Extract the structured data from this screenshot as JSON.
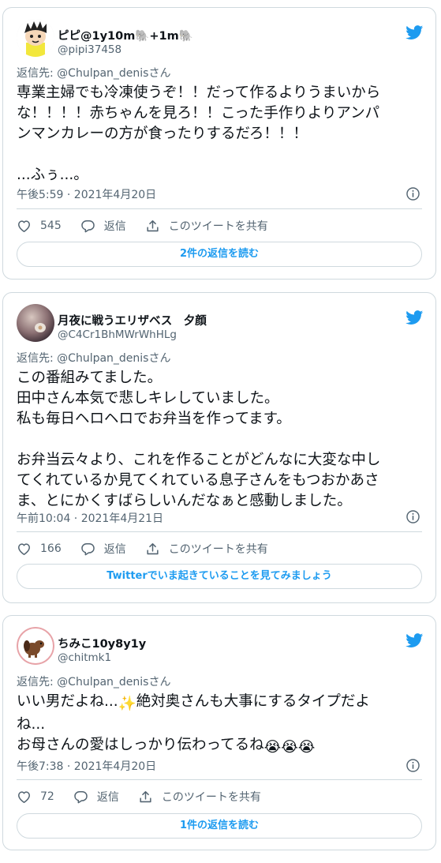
{
  "colors": {
    "accent": "#1d9bf0",
    "secondary_text": "#536471",
    "border": "#cfd9de",
    "text": "#0f1419"
  },
  "tweets": [
    {
      "author": {
        "name": "ピピ@1y10m🐘+1m🐘",
        "handle": "@pipi37458"
      },
      "reply_to": {
        "prefix": "返信先: ",
        "mention": "@Chulpan_denisさん"
      },
      "lines": [
        "専業主婦でも冷凍使うぞ！！だって作るよりうまいから",
        "な！！！！赤ちゃんを見ろ！！こった手作りよりアンパ",
        "ンマンカレーの方が食ったりするだろ！！！",
        "",
        "...ふぅ...。"
      ],
      "timestamp": "午後5:59 · 2021年4月20日",
      "like_count": "545",
      "reply_label": "返信",
      "share_label": "このツイートを共有",
      "button_label": "2件の返信を読む"
    },
    {
      "author": {
        "name": "月夜に戦うエリザベス　夕顔",
        "handle": "@C4Cr1BhMWrWhHLg"
      },
      "reply_to": {
        "prefix": "返信先: ",
        "mention": "@Chulpan_denisさん"
      },
      "lines": [
        "この番組みてました。",
        "田中さん本気で悲しキレしていました。",
        "私も毎日ヘロヘロでお弁当を作ってます。",
        "",
        "お弁当云々より、これを作ることがどんなに大変な中し",
        "てくれているか見てくれている息子さんをもつおかあさ",
        "ま、とにかくすばらしいんだなぁと感動しました。"
      ],
      "timestamp": "午前10:04 · 2021年4月21日",
      "like_count": "166",
      "reply_label": "返信",
      "share_label": "このツイートを共有",
      "button_label": "Twitterでいま起きていることを見てみましょう"
    },
    {
      "author": {
        "name": "ちみこ10y8y1y",
        "handle": "@chitmk1"
      },
      "reply_to": {
        "prefix": "返信先: ",
        "mention": "@Chulpan_denisさん"
      },
      "lines": [
        "いい男だよね...",
        "絶対奥さんも大事にするタイプだよ",
        "ね...",
        "お母さんの愛はしっかり伝わってるね"
      ],
      "emoji": {
        "sparkles": "✨",
        "crying": "😭😭😭"
      },
      "timestamp": "午後7:38 · 2021年4月20日",
      "like_count": "72",
      "reply_label": "返信",
      "share_label": "このツイートを共有",
      "button_label": "1件の返信を読む"
    }
  ],
  "icons": {
    "brand": "twitter-bird-icon",
    "like": "heart-icon",
    "reply": "speech-bubble-icon",
    "share": "share-upload-icon",
    "info": "info-icon"
  }
}
